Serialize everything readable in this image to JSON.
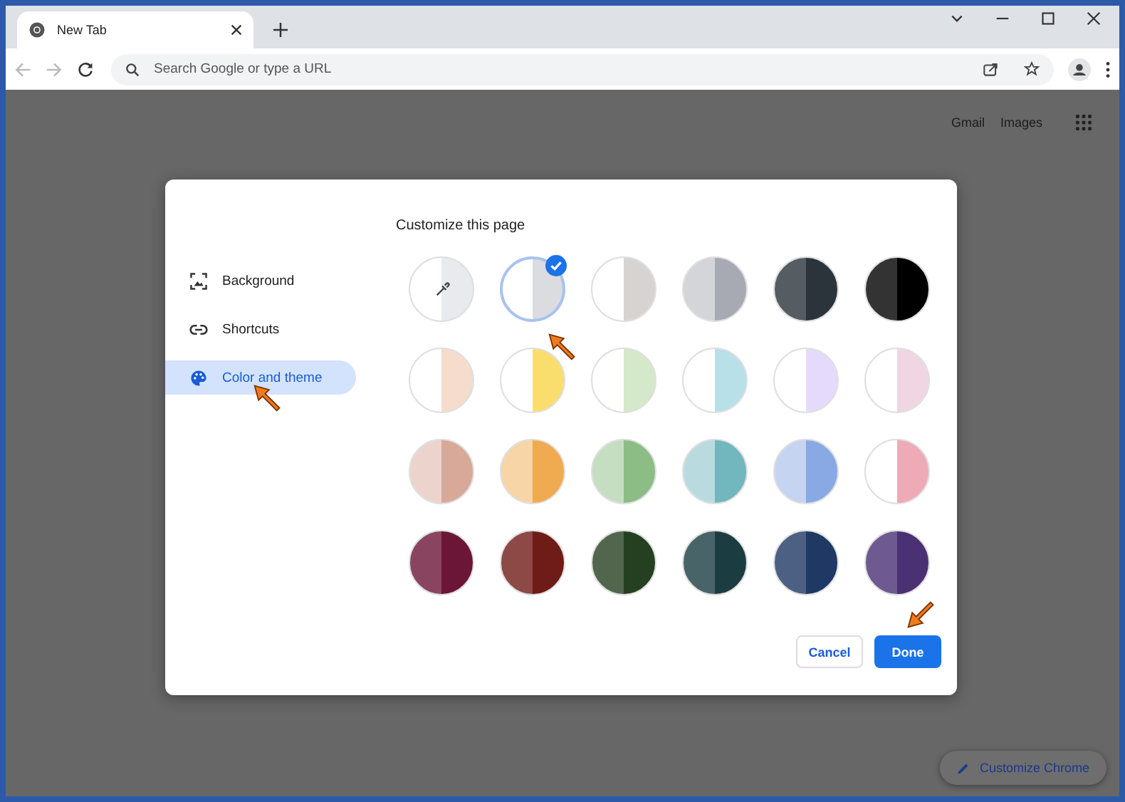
{
  "tab": {
    "title": "New Tab",
    "selected": true
  },
  "address_bar": {
    "placeholder": "Search Google or type a URL"
  },
  "header_links": [
    "Gmail",
    "Images"
  ],
  "dialog": {
    "title": "Customize this page",
    "sidebar": [
      {
        "kind": "background",
        "label": "Background",
        "selected": false
      },
      {
        "kind": "shortcuts",
        "label": "Shortcuts",
        "selected": false
      },
      {
        "kind": "theme",
        "label": "Color and theme",
        "selected": true
      }
    ],
    "swatches": [
      {
        "kind": "custom",
        "color": "#e8eaed",
        "selected": false
      },
      {
        "kind": "swatch",
        "color": "#dadce0",
        "selected": true
      },
      {
        "kind": "swatch",
        "color": "#d7d3d0",
        "selected": false
      },
      {
        "kind": "swatch",
        "color": "#a7aab3",
        "selected": false
      },
      {
        "kind": "swatch",
        "color": "#2b343b",
        "selected": false
      },
      {
        "kind": "swatch",
        "color": "#000000",
        "selected": false
      },
      {
        "kind": "swatch",
        "color": "#f6dccd",
        "selected": false
      },
      {
        "kind": "swatch",
        "color": "#f9de6e",
        "selected": false
      },
      {
        "kind": "swatch",
        "color": "#d3e9c9",
        "selected": false
      },
      {
        "kind": "swatch",
        "color": "#b7e0e9",
        "selected": false
      },
      {
        "kind": "swatch",
        "color": "#e6dafc",
        "selected": false
      },
      {
        "kind": "swatch",
        "color": "#f0d6e3",
        "selected": false
      },
      {
        "kind": "swatch",
        "color": "#d8a899",
        "selected": false
      },
      {
        "kind": "swatch",
        "color": "#f0aa4f",
        "selected": false
      },
      {
        "kind": "swatch",
        "color": "#8bbd85",
        "selected": false
      },
      {
        "kind": "swatch",
        "color": "#72b6be",
        "selected": false
      },
      {
        "kind": "swatch",
        "color": "#88a9e3",
        "selected": false
      },
      {
        "kind": "swatch",
        "color": "#eeaab7",
        "selected": false
      },
      {
        "kind": "swatch",
        "color": "#6b1637",
        "selected": false
      },
      {
        "kind": "swatch",
        "color": "#6f1b17",
        "selected": false
      },
      {
        "kind": "swatch",
        "color": "#254020",
        "selected": false
      },
      {
        "kind": "swatch",
        "color": "#1b3d42",
        "selected": false
      },
      {
        "kind": "swatch",
        "color": "#1f3864",
        "selected": false
      },
      {
        "kind": "swatch",
        "color": "#4a3174",
        "selected": false
      }
    ],
    "buttons": [
      {
        "kind": "secondary",
        "label": "Cancel"
      },
      {
        "kind": "primary",
        "label": "Done"
      }
    ]
  },
  "customize_button": {
    "label": "Customize Chrome"
  }
}
